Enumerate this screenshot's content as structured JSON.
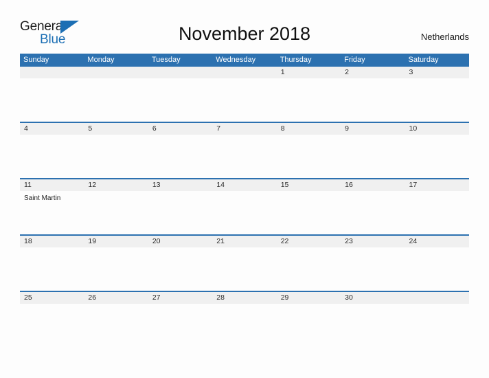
{
  "logo": {
    "primary_text": "General",
    "secondary_text": "Blue",
    "triangle_icon": "triangle-icon",
    "primary_color": "#1b1b1b",
    "secondary_color": "#1c6fb4"
  },
  "header": {
    "title": "November 2018",
    "country": "Netherlands"
  },
  "theme": {
    "header_blue": "#2c71b0",
    "date_band_gray": "#f0f0f0",
    "page_background": "#fdfdfd",
    "text_color": "#2b2b2b"
  },
  "calendar": {
    "weekday_headers": [
      "Sunday",
      "Monday",
      "Tuesday",
      "Wednesday",
      "Thursday",
      "Friday",
      "Saturday"
    ],
    "weeks": [
      {
        "days": [
          {
            "number": "",
            "event": ""
          },
          {
            "number": "",
            "event": ""
          },
          {
            "number": "",
            "event": ""
          },
          {
            "number": "",
            "event": ""
          },
          {
            "number": "1",
            "event": ""
          },
          {
            "number": "2",
            "event": ""
          },
          {
            "number": "3",
            "event": ""
          }
        ]
      },
      {
        "days": [
          {
            "number": "4",
            "event": ""
          },
          {
            "number": "5",
            "event": ""
          },
          {
            "number": "6",
            "event": ""
          },
          {
            "number": "7",
            "event": ""
          },
          {
            "number": "8",
            "event": ""
          },
          {
            "number": "9",
            "event": ""
          },
          {
            "number": "10",
            "event": ""
          }
        ]
      },
      {
        "days": [
          {
            "number": "11",
            "event": "Saint Martin"
          },
          {
            "number": "12",
            "event": ""
          },
          {
            "number": "13",
            "event": ""
          },
          {
            "number": "14",
            "event": ""
          },
          {
            "number": "15",
            "event": ""
          },
          {
            "number": "16",
            "event": ""
          },
          {
            "number": "17",
            "event": ""
          }
        ]
      },
      {
        "days": [
          {
            "number": "18",
            "event": ""
          },
          {
            "number": "19",
            "event": ""
          },
          {
            "number": "20",
            "event": ""
          },
          {
            "number": "21",
            "event": ""
          },
          {
            "number": "22",
            "event": ""
          },
          {
            "number": "23",
            "event": ""
          },
          {
            "number": "24",
            "event": ""
          }
        ]
      },
      {
        "days": [
          {
            "number": "25",
            "event": ""
          },
          {
            "number": "26",
            "event": ""
          },
          {
            "number": "27",
            "event": ""
          },
          {
            "number": "28",
            "event": ""
          },
          {
            "number": "29",
            "event": ""
          },
          {
            "number": "30",
            "event": ""
          },
          {
            "number": "",
            "event": ""
          }
        ]
      }
    ]
  }
}
